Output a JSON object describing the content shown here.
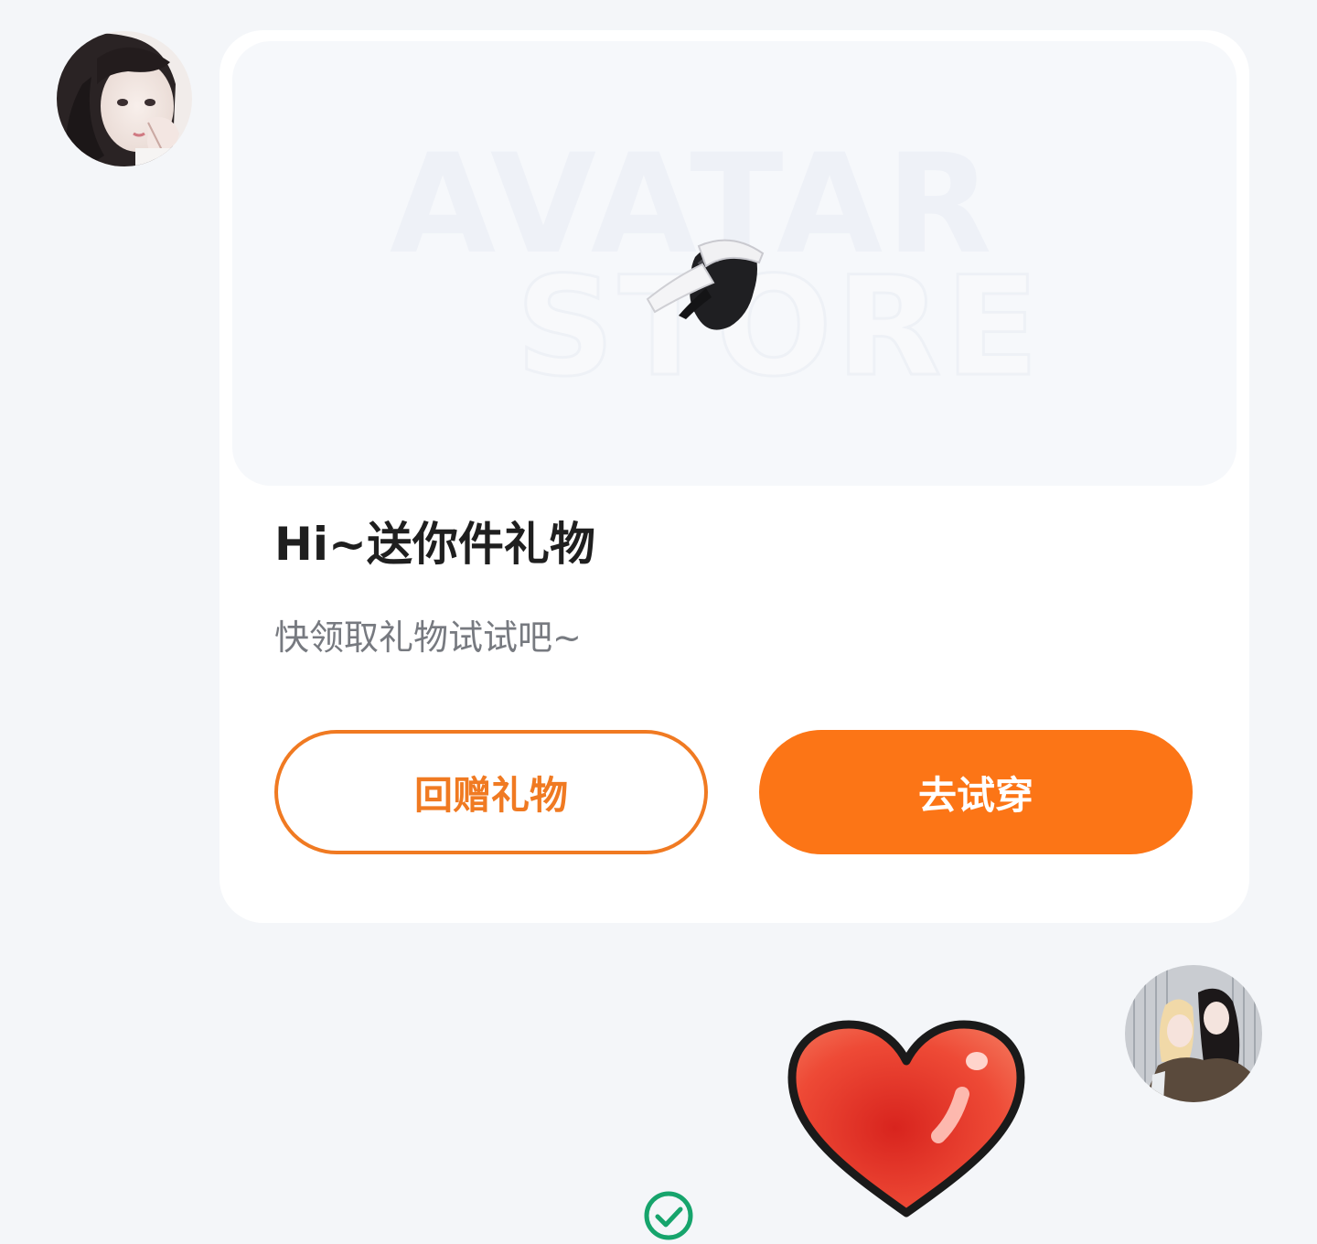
{
  "message_card": {
    "banner": {
      "watermark_line1": "AVATAR",
      "watermark_line2": "STORE",
      "item_icon": "black-bunny-ear-hat-icon"
    },
    "title": "Hi~送你件礼物",
    "subtitle": "快领取礼物试试吧~",
    "buttons": {
      "return_gift": "回赠礼物",
      "try_on": "去试穿"
    }
  },
  "reply": {
    "sticker": "red-heart-icon"
  },
  "status": {
    "icon": "check-circle-icon"
  },
  "colors": {
    "accent": "#fc7516",
    "outline": "#f07a22",
    "check": "#16a46c",
    "heart": "#e83a2c"
  }
}
